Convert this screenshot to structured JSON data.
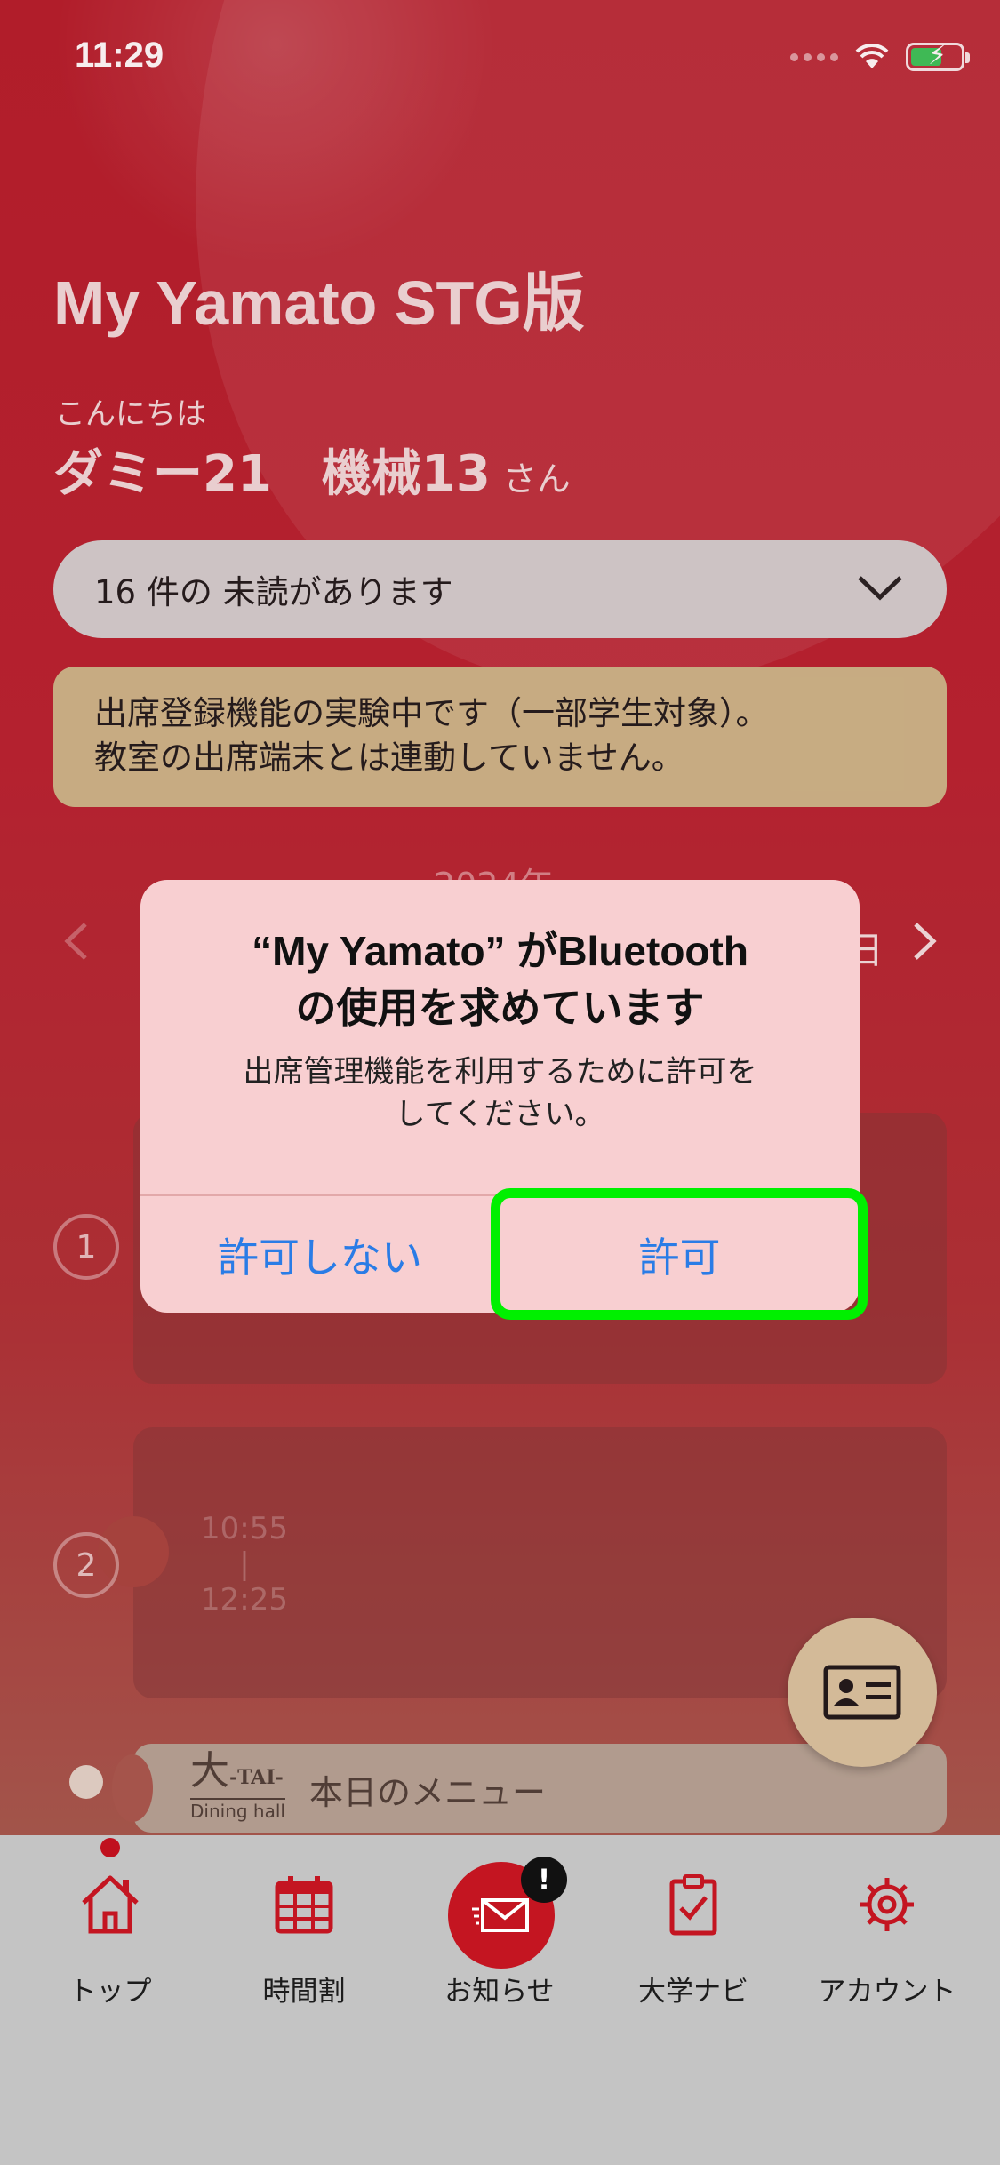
{
  "status_bar": {
    "time": "11:29"
  },
  "header": {
    "app_title": "My Yamato STG版",
    "greeting": "こんにちは",
    "user_name": "ダミー21　機械13",
    "honorific": "さん"
  },
  "unread": {
    "text": "16 件の 未読があります"
  },
  "notice": {
    "line1": "出席登録機能の実験中です（一部学生対象）。",
    "line2": "教室の出席端末とは連動していません。"
  },
  "schedule": {
    "year_partial": "2024年",
    "day_fragment": "日",
    "periods": [
      {
        "number": "1"
      },
      {
        "number": "2",
        "start": "10:55",
        "separator": "|",
        "end": "12:25"
      }
    ],
    "dining": {
      "logo_main": "大",
      "logo_suffix": "-TAI-",
      "logo_sub": "Dining hall",
      "label": "本日のメニュー"
    }
  },
  "dialog": {
    "title_line1": "“My Yamato” がBluetooth",
    "title_line2": "の使用を求めています",
    "message_line1": "出席管理機能を利用するために許可を",
    "message_line2": "してください。",
    "deny_label": "許可しない",
    "allow_label": "許可"
  },
  "tabbar": {
    "items": [
      {
        "label": "トップ",
        "icon": "home-icon"
      },
      {
        "label": "時間割",
        "icon": "calendar-icon"
      },
      {
        "label": "お知らせ",
        "icon": "mail-icon",
        "badge": "!"
      },
      {
        "label": "大学ナビ",
        "icon": "clipboard-check-icon"
      },
      {
        "label": "アカウント",
        "icon": "gear-icon"
      }
    ]
  },
  "colors": {
    "brand_red": "#b41e2b",
    "dialog_button": "#2a7ce6",
    "highlight": "#00f000"
  }
}
